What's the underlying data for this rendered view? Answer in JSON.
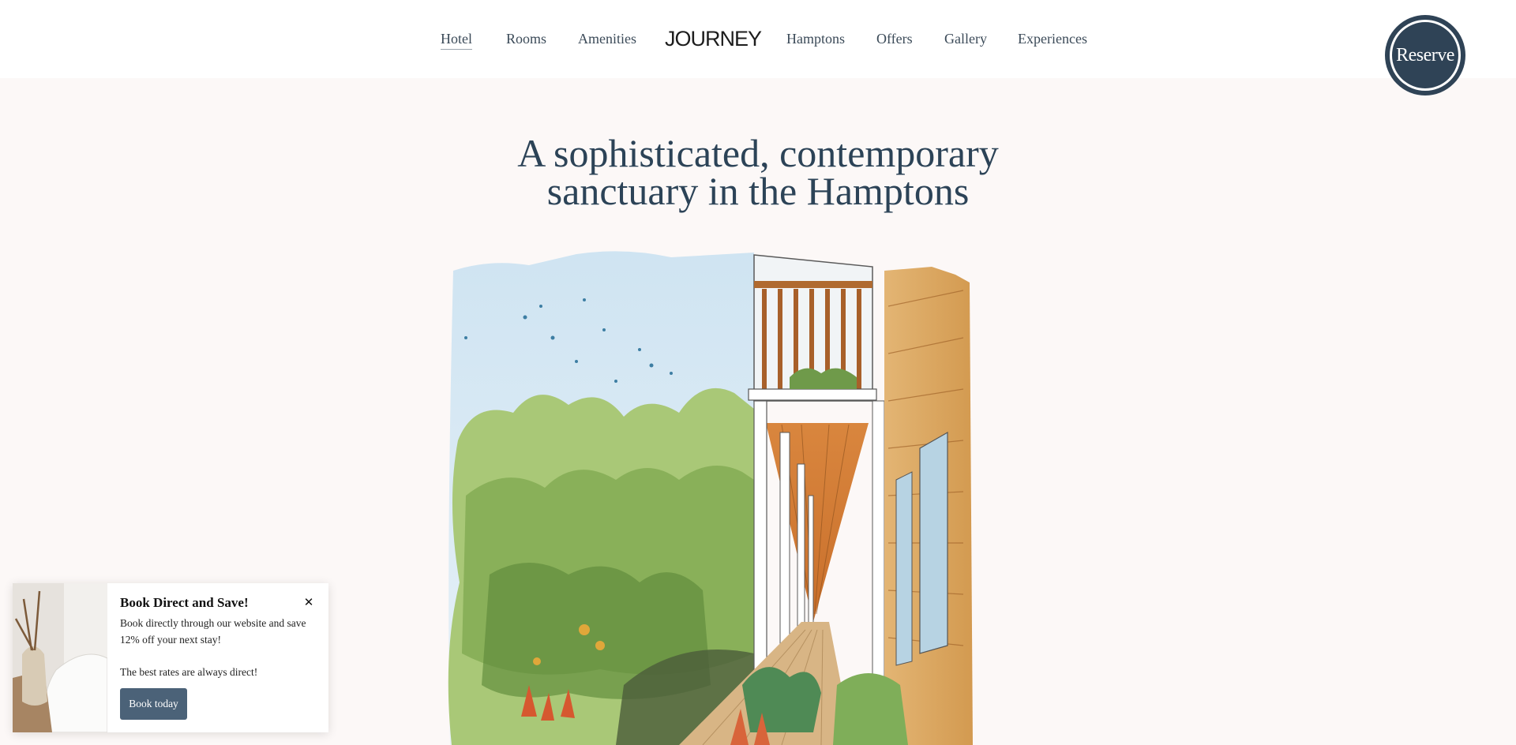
{
  "nav": {
    "logo": "JOURNEY",
    "items": [
      {
        "label": "Hotel",
        "active": true
      },
      {
        "label": "Rooms"
      },
      {
        "label": "Amenities"
      },
      {
        "label": "Hamptons"
      },
      {
        "label": "Offers"
      },
      {
        "label": "Gallery"
      },
      {
        "label": "Experiences"
      }
    ],
    "reserve_label": "Reserve"
  },
  "hero": {
    "title_line1": "A sophisticated, contemporary",
    "title_line2": "sanctuary in the Hamptons"
  },
  "popup": {
    "title": "Book Direct and Save!",
    "body_line1": "Book directly through our website and save 12% off your next stay!",
    "body_line2": "The best rates are always direct!",
    "button_label": "Book today",
    "close_icon": "close-icon"
  },
  "colors": {
    "brand_navy": "#2f4356",
    "button_blue": "#4b6278",
    "page_background": "#fcf8f7"
  }
}
